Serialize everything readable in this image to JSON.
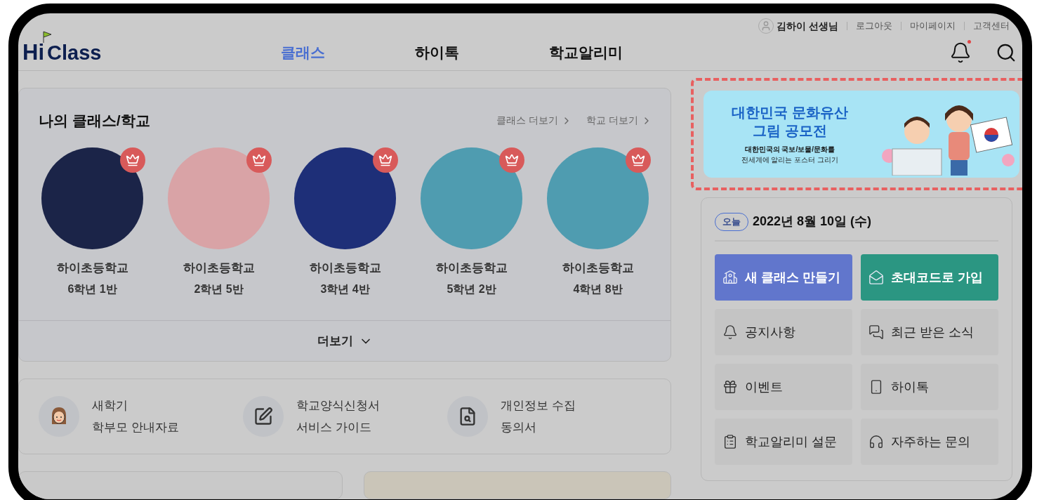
{
  "header": {
    "logo": {
      "hi": "Hi",
      "rest": "Class"
    },
    "user": "김하이 선생님",
    "links": [
      "로그아웃",
      "마이페이지",
      "고객센터"
    ],
    "nav": [
      {
        "label": "클래스",
        "selected": true
      },
      {
        "label": "하이톡",
        "selected": false
      },
      {
        "label": "학교알리미",
        "selected": false
      }
    ],
    "has_new_notification": true
  },
  "my_classes": {
    "title": "나의 클래스/학교",
    "links": [
      "클래스 더보기",
      "학교 더보기"
    ],
    "classes": [
      {
        "school": "하이초등학교",
        "grade": "6학년 1반",
        "color": "#1b2448",
        "owner": true
      },
      {
        "school": "하이초등학교",
        "grade": "2학년 5반",
        "color": "#d9a3a6",
        "owner": true
      },
      {
        "school": "하이초등학교",
        "grade": "3학년 4반",
        "color": "#1e2f78",
        "owner": true
      },
      {
        "school": "하이초등학교",
        "grade": "5학년 2반",
        "color": "#4f9cb0",
        "owner": true
      },
      {
        "school": "하이초등학교",
        "grade": "4학년 8반",
        "color": "#4f9cb0",
        "owner": true
      }
    ],
    "more": "더보기"
  },
  "guides": [
    {
      "kind": "parent",
      "lines": [
        "새학기",
        "학부모 안내자료"
      ]
    },
    {
      "kind": "form",
      "lines": [
        "학교양식신청서",
        "서비스 가이드"
      ]
    },
    {
      "kind": "privacy",
      "lines": [
        "개인정보 수집",
        "동의서"
      ]
    }
  ],
  "banner": {
    "highlighted": true,
    "title_lines": [
      "대한민국 문화유산",
      "그림 공모전"
    ],
    "subtitle": "대한민국의 국보/보물/문화를",
    "caption": "전세계에 알리는 포스터 그리기"
  },
  "today": {
    "badge": "오늘",
    "date": "2022년 8월 10일 (수)"
  },
  "actions": [
    {
      "kind": "create",
      "label": "새 클래스 만들기",
      "color": "#6176cc"
    },
    {
      "kind": "invite",
      "label": "초대코드로 가입",
      "color": "#2b9682"
    },
    {
      "kind": "notice",
      "label": "공지사항",
      "color": "#c4c4c4"
    },
    {
      "kind": "news",
      "label": "최근 받은 소식",
      "color": "#c4c4c4"
    },
    {
      "kind": "event",
      "label": "이벤트",
      "color": "#c4c4c4"
    },
    {
      "kind": "talk",
      "label": "하이톡",
      "color": "#c4c4c4"
    },
    {
      "kind": "survey",
      "label": "학교알리미 설문",
      "color": "#c4c4c4"
    },
    {
      "kind": "faq",
      "label": "자주하는 문의",
      "color": "#c4c4c4"
    }
  ]
}
